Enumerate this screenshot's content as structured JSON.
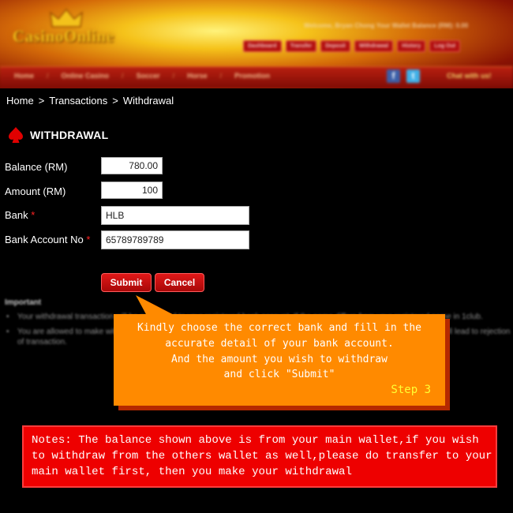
{
  "header": {
    "logo_text": "CasinoOnline",
    "welcome_text": "Welcome, Bryan Chong    Your Wallet Balance (RM): 0.00",
    "top_buttons": [
      "Dashboard",
      "Transfer",
      "Deposit",
      "Withdrawal",
      "History",
      "Log Out"
    ],
    "nav_items": [
      "Home",
      "Online Casino",
      "Soccer",
      "Horse",
      "Promotion"
    ],
    "social": {
      "facebook": "f",
      "twitter": "t"
    },
    "chat_text": "Chat with us!"
  },
  "breadcrumb": {
    "items": [
      "Home",
      "Transactions",
      "Withdrawal"
    ],
    "separator": ">"
  },
  "page": {
    "title": "WITHDRAWAL"
  },
  "form": {
    "balance": {
      "label": "Balance (RM)",
      "value": "780.00"
    },
    "amount": {
      "label": "Amount (RM)",
      "value": "100"
    },
    "bank": {
      "label": "Bank",
      "required_mark": "*",
      "value": "HLB"
    },
    "account_no": {
      "label": "Bank Account No",
      "required_mark": "*",
      "value": "65789789789"
    },
    "submit_label": "Submit",
    "cancel_label": "Cancel"
  },
  "important": {
    "title": "Important",
    "bullets": [
      "Your withdrawal transaction will be processed to your registered bank account. If the name differs from your registered name in 1club.",
      "You are allowed to make withdrawal to your own bank account only. Withdrawals made to another person's bank account will lead to rejection of transaction."
    ]
  },
  "callout": {
    "lines": [
      "Kindly choose the correct bank and fill in the",
      "accurate detail of your bank account.",
      "And the amount you wish to withdraw",
      "and click \"Submit\""
    ],
    "step": "Step 3"
  },
  "notes": {
    "lines": [
      "Notes: The balance shown above is from your main wallet,if you wish",
      "to withdraw from the others wallet as well,please do transfer to your",
      "main wallet first, then you make your withdrawal"
    ]
  },
  "colors": {
    "accent_red": "#ee0000",
    "callout_orange": "#ff8a00",
    "step_yellow": "#ffff33"
  }
}
